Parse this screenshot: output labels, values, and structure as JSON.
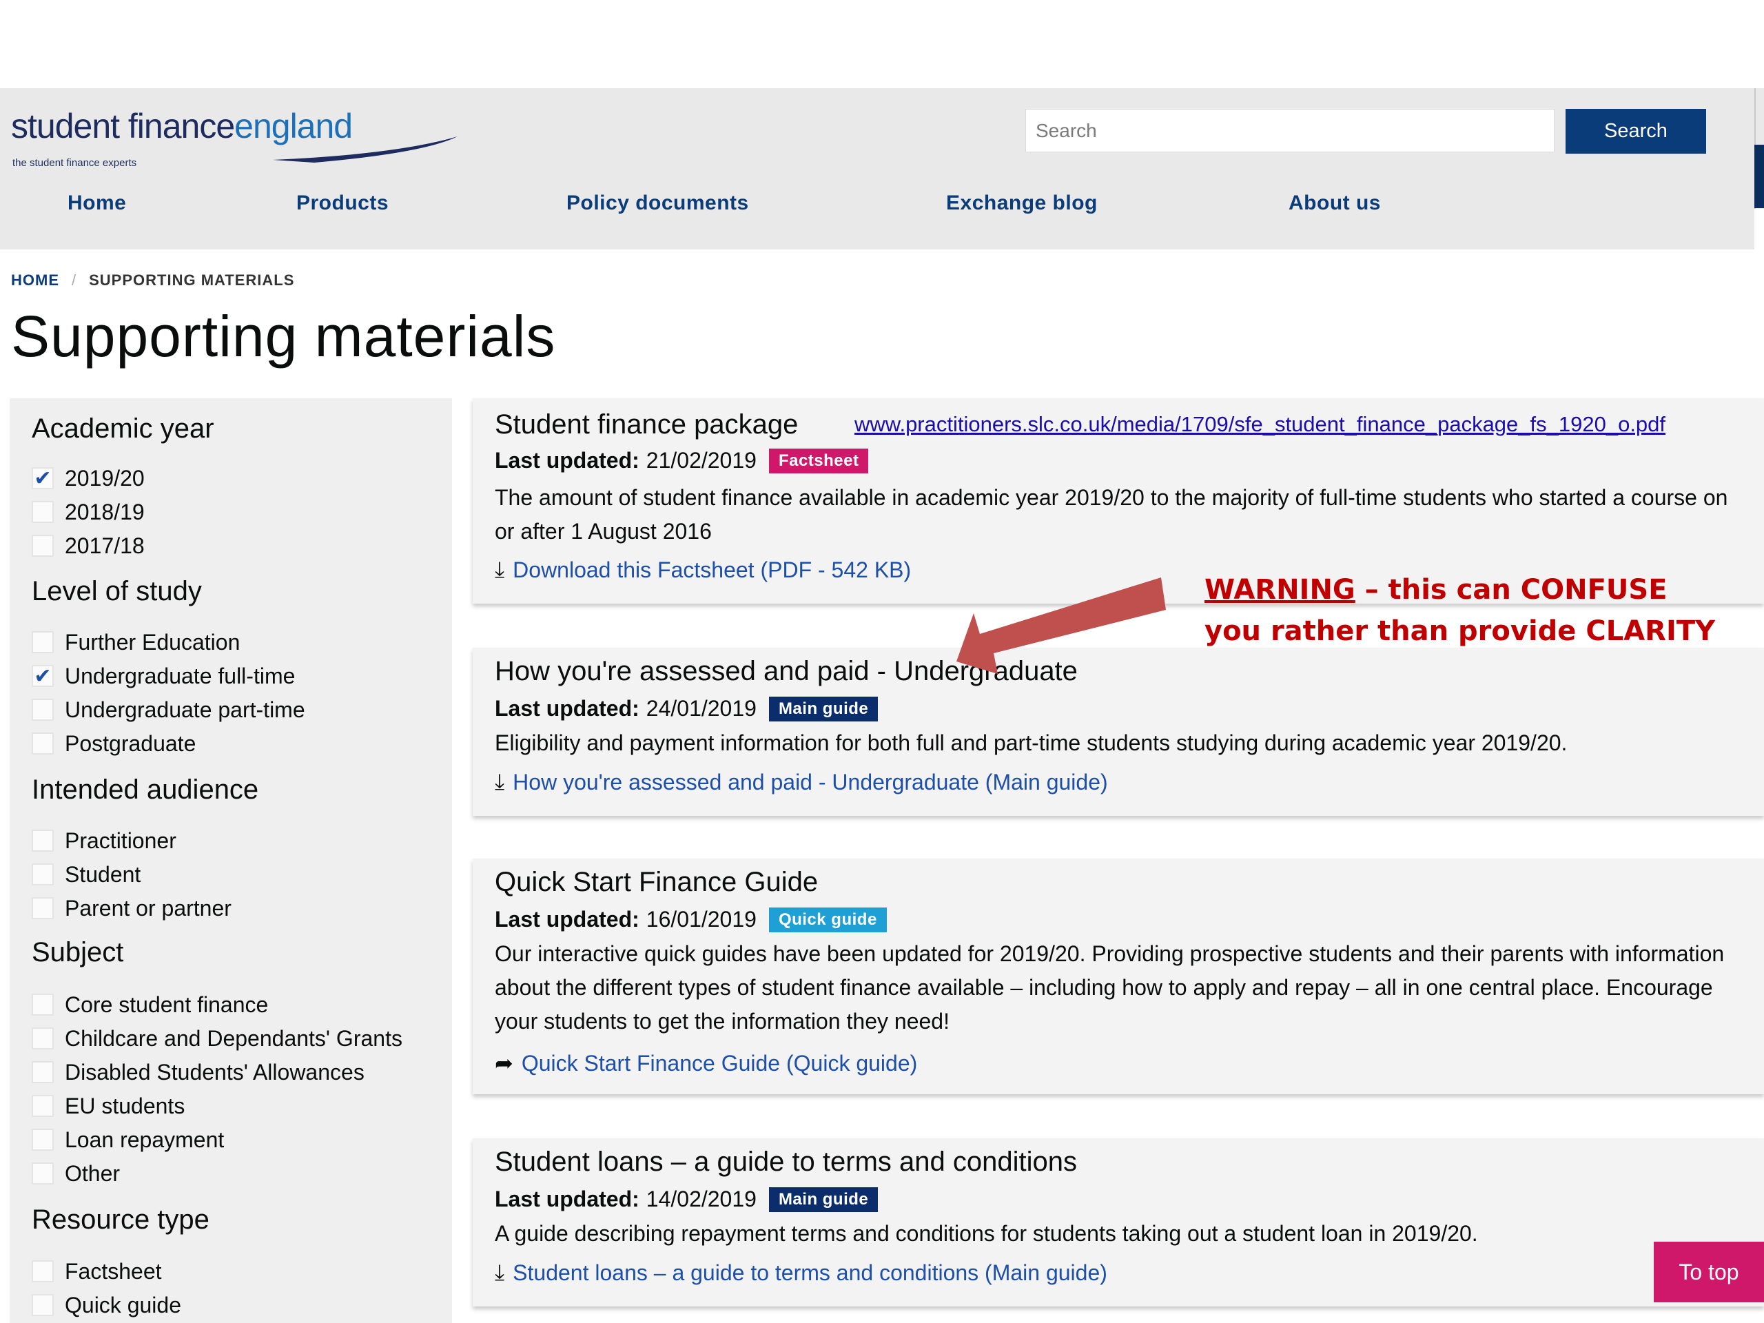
{
  "brand": {
    "name_part1": "student finance",
    "name_part2": "england",
    "tagline": "the student finance experts"
  },
  "search": {
    "placeholder": "Search",
    "button_label": "Search"
  },
  "nav": [
    "Home",
    "Products",
    "Policy documents",
    "Exchange blog",
    "About us"
  ],
  "breadcrumb": {
    "home": "HOME",
    "separator": "/",
    "current": "SUPPORTING MATERIALS"
  },
  "page_title": "Supporting materials",
  "filters": [
    {
      "heading": "Academic year",
      "options": [
        {
          "label": "2019/20",
          "checked": true
        },
        {
          "label": "2018/19",
          "checked": false
        },
        {
          "label": "2017/18",
          "checked": false
        }
      ]
    },
    {
      "heading": "Level of study",
      "options": [
        {
          "label": "Further Education",
          "checked": false
        },
        {
          "label": "Undergraduate full-time",
          "checked": true
        },
        {
          "label": "Undergraduate part-time",
          "checked": false
        },
        {
          "label": "Postgraduate",
          "checked": false
        }
      ]
    },
    {
      "heading": "Intended audience",
      "options": [
        {
          "label": "Practitioner",
          "checked": false
        },
        {
          "label": "Student",
          "checked": false
        },
        {
          "label": "Parent or partner",
          "checked": false
        }
      ]
    },
    {
      "heading": "Subject",
      "options": [
        {
          "label": "Core student finance",
          "checked": false
        },
        {
          "label": "Childcare and Dependants' Grants",
          "checked": false
        },
        {
          "label": "Disabled Students' Allowances",
          "checked": false
        },
        {
          "label": "EU students",
          "checked": false
        },
        {
          "label": "Loan repayment",
          "checked": false
        },
        {
          "label": "Other",
          "checked": false
        }
      ]
    },
    {
      "heading": "Resource type",
      "options": [
        {
          "label": "Factsheet",
          "checked": false
        },
        {
          "label": "Quick guide",
          "checked": false
        }
      ]
    }
  ],
  "results": [
    {
      "title": "Student finance package",
      "url": "www.practitioners.slc.co.uk/media/1709/sfe_student_finance_package_fs_1920_o.pdf",
      "updated_label": "Last updated:",
      "updated": "21/02/2019",
      "badge": "Factsheet",
      "badge_color": "#d0186b",
      "description": "The amount of student finance available in academic year 2019/20 to the majority of full-time students who started a course on or after 1 August 2016",
      "link_icon": "download-icon",
      "link": "Download this Factsheet (PDF - 542 KB)"
    },
    {
      "title": "How you're assessed and paid - Undergraduate",
      "updated_label": "Last updated:",
      "updated": "24/01/2019",
      "badge": "Main guide",
      "badge_color": "#0b2d6b",
      "description": "Eligibility and payment information for both full and part-time students studying during academic year 2019/20.",
      "link_icon": "download-icon",
      "link": "How you're assessed and paid - Undergraduate (Main guide)"
    },
    {
      "title": "Quick Start Finance Guide",
      "updated_label": "Last updated:",
      "updated": "16/01/2019",
      "badge": "Quick guide",
      "badge_color": "#1ea0d6",
      "description": "Our interactive quick guides have been updated for 2019/20. Providing prospective students and their parents with information about the different types of student finance available – including how to apply and repay – all in one central place. Encourage your students to get the information they need!",
      "link_icon": "cursor-icon",
      "link": "Quick Start Finance Guide (Quick guide)"
    },
    {
      "title": "Student loans – a guide to terms and conditions",
      "updated_label": "Last updated:",
      "updated": "14/02/2019",
      "badge": "Main guide",
      "badge_color": "#0b2d6b",
      "description": "A guide describing repayment terms and conditions for students taking out a student loan in 2019/20.",
      "link_icon": "download-icon",
      "link": "Student loans – a guide to terms and conditions (Main guide)"
    }
  ],
  "annotation": {
    "warning_word": "WARNING",
    "line1_rest": " – this can CONFUSE",
    "line2": "you rather than provide CLARITY",
    "color": "#c00000",
    "arrow_color": "#c0504d"
  },
  "to_top": "To top"
}
